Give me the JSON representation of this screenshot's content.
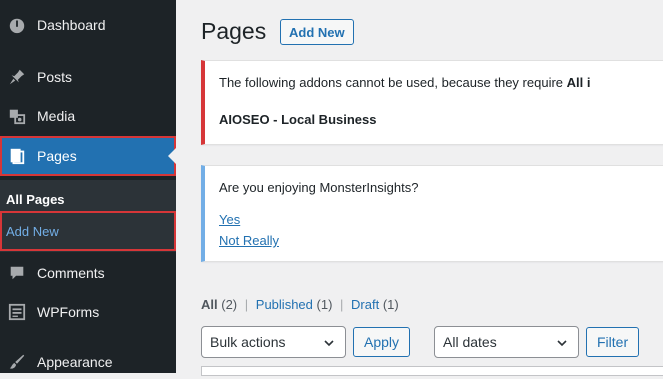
{
  "colors": {
    "sidebar_bg": "#1d2327",
    "active_bg": "#2271b1",
    "highlight_outline": "#d63638",
    "link": "#2271b1",
    "error_border": "#d63638",
    "info_border": "#72aee6"
  },
  "sidebar": {
    "items": [
      {
        "label": "Dashboard",
        "icon": "dashboard-icon"
      },
      {
        "label": "Posts",
        "icon": "pin-icon"
      },
      {
        "label": "Media",
        "icon": "media-icon"
      },
      {
        "label": "Pages",
        "icon": "pages-icon"
      },
      {
        "label": "Comments",
        "icon": "comment-icon"
      },
      {
        "label": "WPForms",
        "icon": "forms-icon"
      },
      {
        "label": "Appearance",
        "icon": "brush-icon"
      }
    ],
    "submenu": {
      "all_pages": "All Pages",
      "add_new": "Add New"
    }
  },
  "header": {
    "title": "Pages",
    "add_new_label": "Add New"
  },
  "notices": {
    "addons": {
      "message_start": "The following addons cannot be used, because they require ",
      "message_bold": "All i",
      "addon_name": "AIOSEO - Local Business"
    },
    "monsterinsights": {
      "question": "Are you enjoying MonsterInsights?",
      "yes": "Yes",
      "no": "Not Really"
    }
  },
  "filters": {
    "all_label": "All",
    "all_count": "(2)",
    "sep": "|",
    "published_label": "Published",
    "published_count": "(1)",
    "draft_label": "Draft",
    "draft_count": "(1)"
  },
  "toolbar": {
    "bulk_actions": "Bulk actions",
    "apply": "Apply",
    "dates": "All dates",
    "filter": "Filter"
  }
}
